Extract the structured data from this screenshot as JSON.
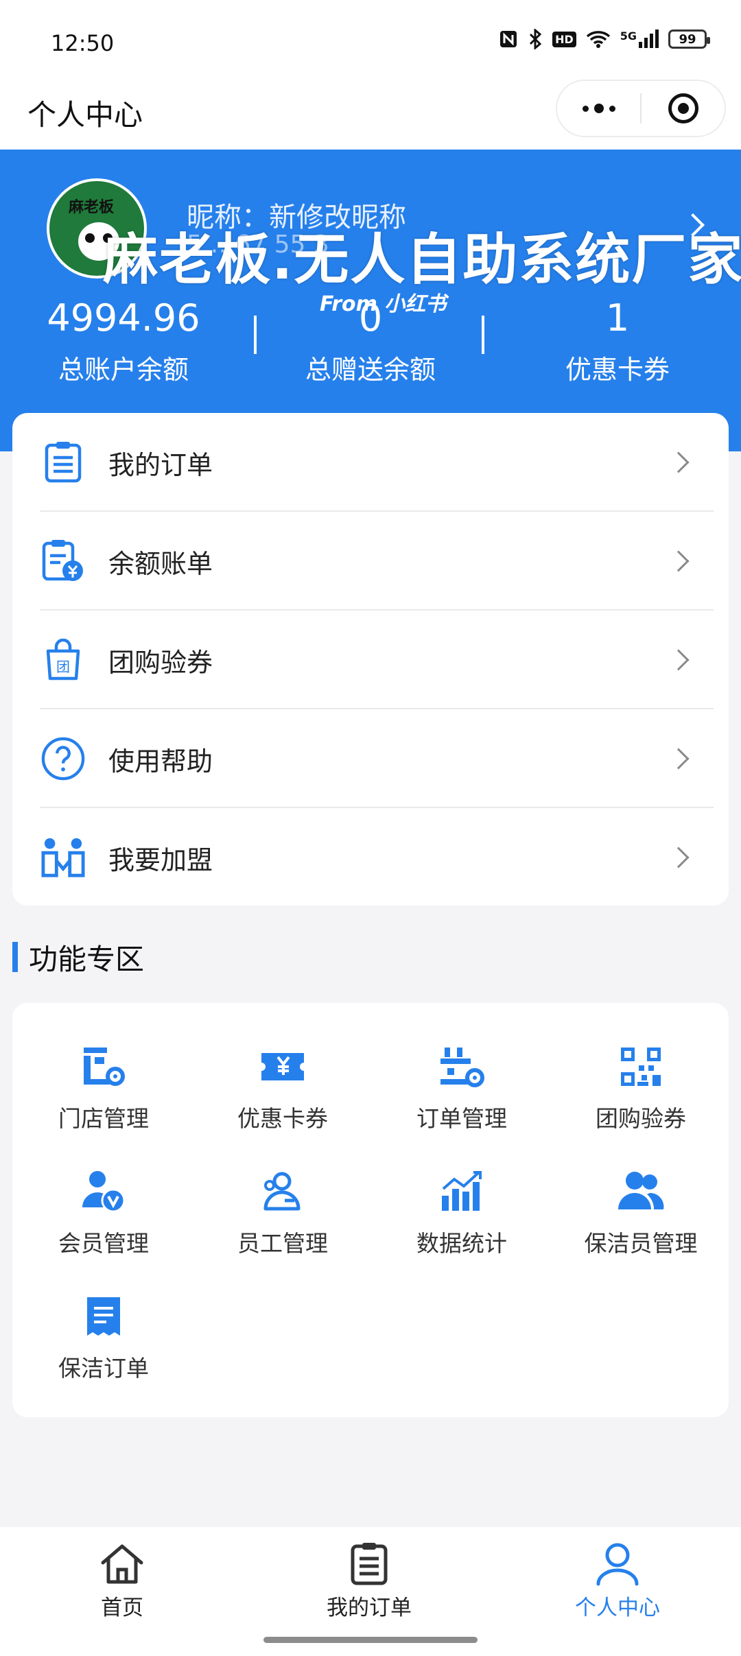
{
  "status_bar": {
    "time": "12:50",
    "icons": [
      "nfc-icon",
      "bluetooth-icon",
      "hd-icon",
      "wifi-icon",
      "5g-signal-icon"
    ],
    "hd_label": "HD",
    "network_label": "5G",
    "battery": "99"
  },
  "nav": {
    "title": "个人中心",
    "icons": [
      "more-icon",
      "target-icon"
    ]
  },
  "colors": {
    "accent": "#2680eb",
    "page_bg": "#f4f4f6"
  },
  "profile": {
    "avatar_text": "麻老板",
    "nickname": "昵称：新修改昵称",
    "phone_partial": "5 …67 55 3",
    "watermark": "麻老板.无人自助系统厂家",
    "watermark_sub": "From 小红书"
  },
  "stats": [
    {
      "value": "4994.96",
      "label": "总账户余额"
    },
    {
      "value": "0",
      "label": "总赠送余额"
    },
    {
      "value": "1",
      "label": "优惠卡券"
    }
  ],
  "menu": [
    {
      "label": "我的订单",
      "icon": "clipboard-list-icon"
    },
    {
      "label": "余额账单",
      "icon": "bill-yuan-icon"
    },
    {
      "label": "团购验券",
      "icon": "group-bag-icon"
    },
    {
      "label": "使用帮助",
      "icon": "help-circle-icon"
    },
    {
      "label": "我要加盟",
      "icon": "join-people-icon"
    }
  ],
  "section": {
    "title": "功能专区"
  },
  "functions": [
    {
      "label": "门店管理",
      "icon": "store-manage-icon"
    },
    {
      "label": "优惠卡券",
      "icon": "coupon-icon"
    },
    {
      "label": "订单管理",
      "icon": "order-manage-icon"
    },
    {
      "label": "团购验券",
      "icon": "qr-verify-icon"
    },
    {
      "label": "会员管理",
      "icon": "member-icon"
    },
    {
      "label": "员工管理",
      "icon": "staff-icon"
    },
    {
      "label": "数据统计",
      "icon": "chart-icon"
    },
    {
      "label": "保洁员管理",
      "icon": "cleaners-icon"
    },
    {
      "label": "保洁订单",
      "icon": "cleaning-order-icon"
    }
  ],
  "tabs": [
    {
      "label": "首页",
      "icon": "home-icon",
      "active": false
    },
    {
      "label": "我的订单",
      "icon": "orders-icon",
      "active": false
    },
    {
      "label": "个人中心",
      "icon": "profile-icon",
      "active": true
    }
  ]
}
